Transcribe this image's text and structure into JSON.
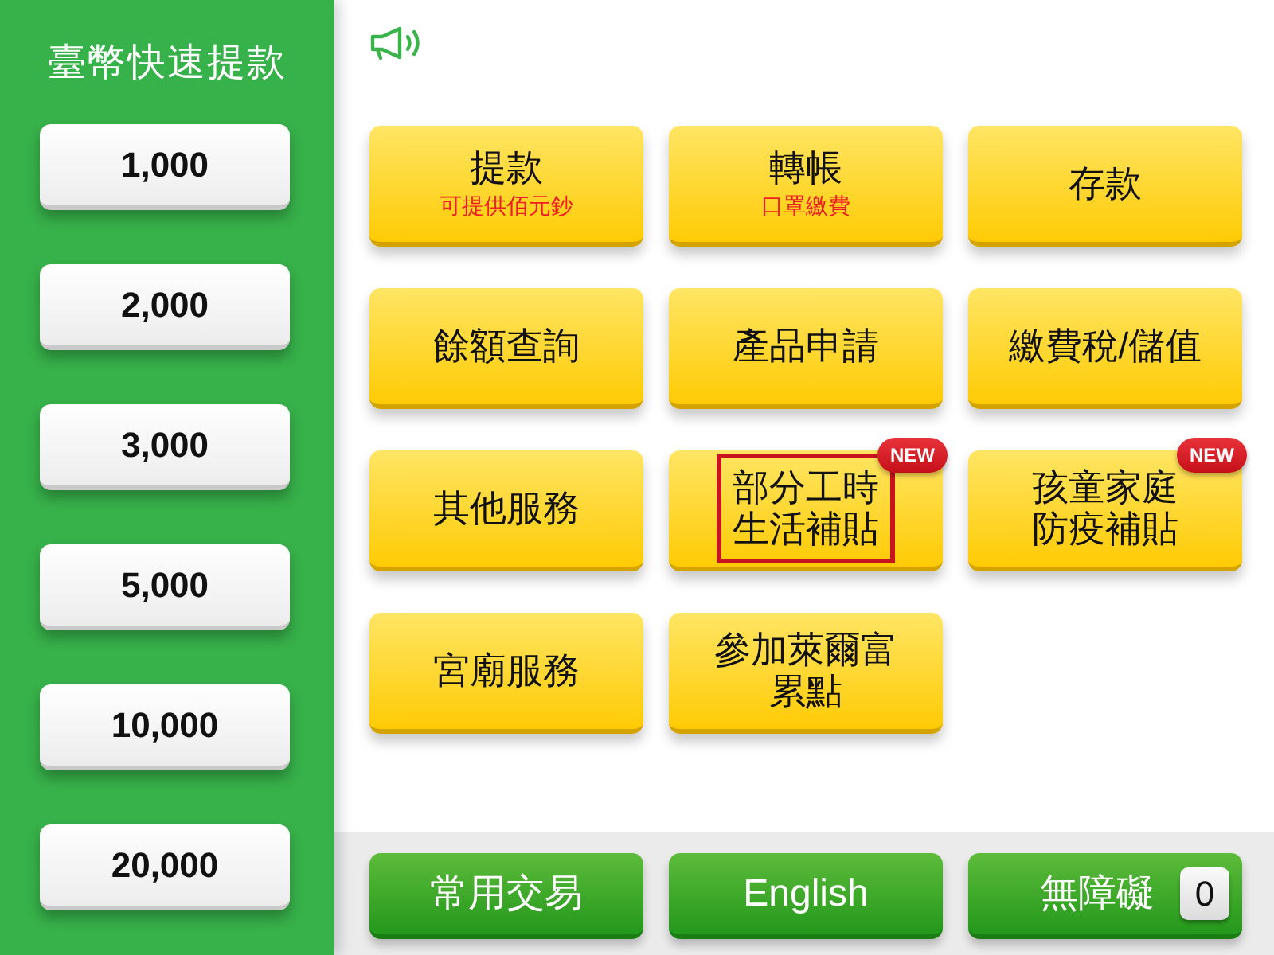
{
  "sidebar": {
    "title": "臺幣快速提款",
    "amounts": [
      "1,000",
      "2,000",
      "3,000",
      "5,000",
      "10,000",
      "20,000"
    ]
  },
  "services": [
    {
      "lines": [
        "提款"
      ],
      "note": "可提供佰元鈔",
      "highlighted": false
    },
    {
      "lines": [
        "轉帳"
      ],
      "note": "口罩繳費",
      "highlighted": false
    },
    {
      "lines": [
        "存款"
      ],
      "highlighted": false
    },
    {
      "lines": [
        "餘額查詢"
      ],
      "highlighted": false
    },
    {
      "lines": [
        "產品申請"
      ],
      "highlighted": false
    },
    {
      "lines": [
        "繳費稅/儲值"
      ],
      "highlighted": false
    },
    {
      "lines": [
        "其他服務"
      ],
      "highlighted": false
    },
    {
      "lines": [
        "部分工時",
        "生活補貼"
      ],
      "badge": "NEW",
      "highlighted": true
    },
    {
      "lines": [
        "孩童家庭",
        "防疫補貼"
      ],
      "badge": "NEW",
      "highlighted": false
    },
    {
      "lines": [
        "宮廟服務"
      ],
      "highlighted": false
    },
    {
      "lines": [
        "參加萊爾富",
        "累點"
      ],
      "highlighted": false
    }
  ],
  "footer": [
    {
      "label": "常用交易"
    },
    {
      "label": "English"
    },
    {
      "label": "無障礙",
      "key": "0"
    }
  ]
}
